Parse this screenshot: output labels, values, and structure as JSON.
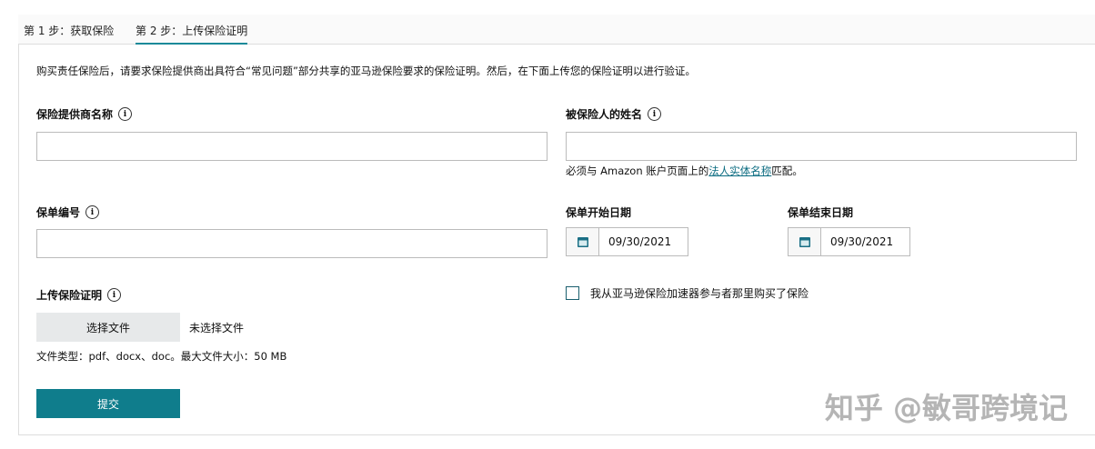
{
  "tabs": [
    {
      "label": "第 1 步：获取保险"
    },
    {
      "label": "第 2 步：上传保险证明"
    }
  ],
  "intro": "购买责任保险后，请要求保险提供商出具符合“常见问题”部分共享的亚马逊保险要求的保险证明。然后，在下面上传您的保险证明以进行验证。",
  "fields": {
    "provider_label": "保险提供商名称",
    "insured_label": "被保险人的姓名",
    "insured_help_pre": "必须与 Amazon 账户页面上的",
    "insured_help_link": "法人实体名称",
    "insured_help_post": "匹配。",
    "policy_label": "保单编号",
    "start_label": "保单开始日期",
    "start_value": "09/30/2021",
    "end_label": "保单结束日期",
    "end_value": "09/30/2021",
    "upload_label": "上传保险证明",
    "choose_file": "选择文件",
    "no_file": "未选择文件",
    "file_types": "文件类型：pdf、docx、doc。最大文件大小：50 MB",
    "checkbox_label": "我从亚马逊保险加速器参与者那里购买了保险"
  },
  "submit": "提交",
  "watermark": "知乎 @敏哥跨境记",
  "colors": {
    "accent": "#0f7d8c"
  }
}
